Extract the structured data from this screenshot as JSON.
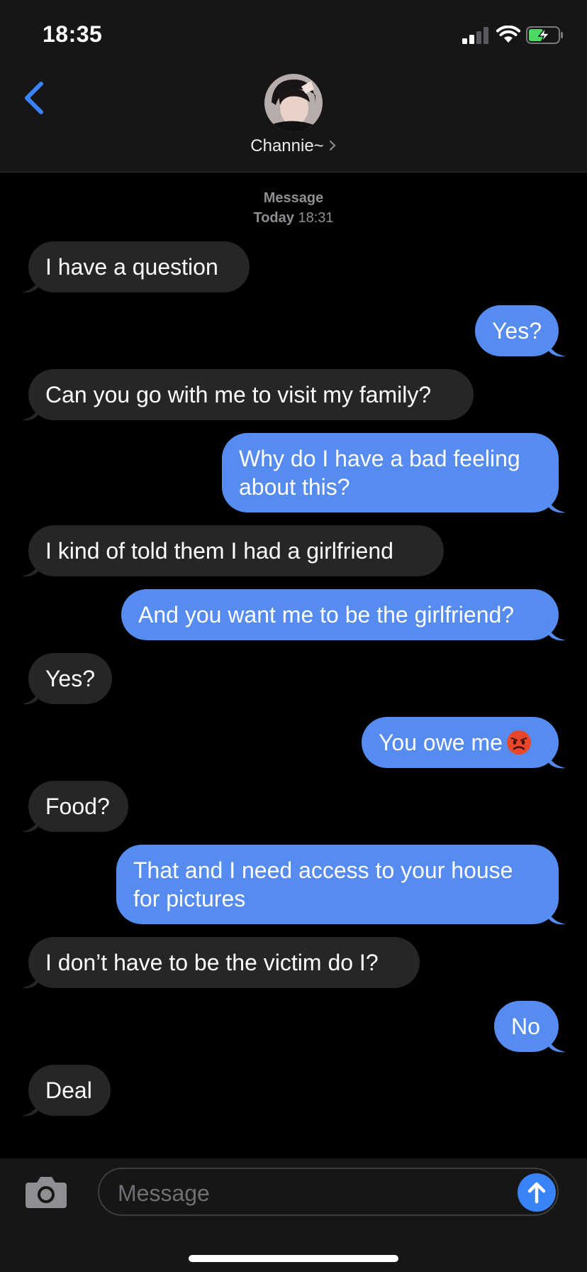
{
  "status": {
    "time": "18:35"
  },
  "header": {
    "contact_name": "Channie~"
  },
  "timestamp": {
    "line1": "Message",
    "day": "Today",
    "time": "18:31"
  },
  "messages": [
    {
      "dir": "in",
      "text": "I have a question"
    },
    {
      "dir": "out",
      "text": "Yes?"
    },
    {
      "dir": "in",
      "text": "Can you go with me to visit my family?"
    },
    {
      "dir": "out",
      "text": "Why do I have a bad feeling\nabout this?"
    },
    {
      "dir": "in",
      "text": "I kind of told them I had a girlfriend"
    },
    {
      "dir": "out",
      "text": "And you want me to be the girlfriend?"
    },
    {
      "dir": "in",
      "text": "Yes?"
    },
    {
      "dir": "out",
      "text": "You owe me",
      "emoji": "angry-face"
    },
    {
      "dir": "in",
      "text": "Food?"
    },
    {
      "dir": "out",
      "text": "That and I need access to your house\nfor pictures"
    },
    {
      "dir": "in",
      "text": "I don’t have to be the victim do I?"
    },
    {
      "dir": "out",
      "text": "No"
    },
    {
      "dir": "in",
      "text": "Deal"
    }
  ],
  "composer": {
    "placeholder": "Message"
  },
  "colors": {
    "incoming": "#262628",
    "outgoing": "#568bef",
    "accent": "#3a82f7"
  }
}
